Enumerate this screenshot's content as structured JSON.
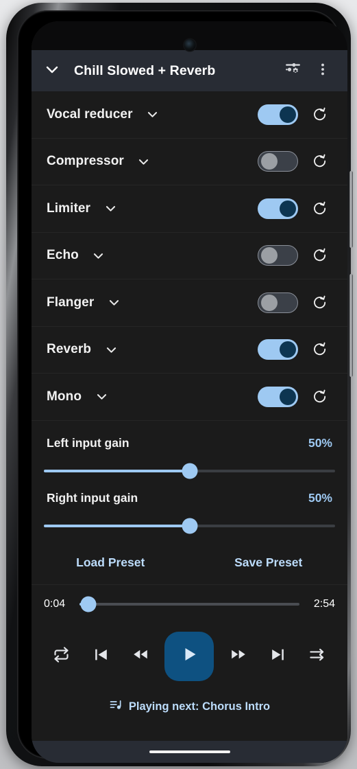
{
  "header": {
    "collapse_icon": "chevron-down-icon",
    "title": "Chill Slowed + Reverb",
    "tune_icon": "tune-settings-icon",
    "overflow_icon": "more-vertical-icon"
  },
  "effects": [
    {
      "name": "Vocal reducer",
      "enabled": true,
      "expand_icon": "chevron-down-icon",
      "reset_icon": "reset-icon"
    },
    {
      "name": "Compressor",
      "enabled": false,
      "expand_icon": "chevron-down-icon",
      "reset_icon": "reset-icon"
    },
    {
      "name": "Limiter",
      "enabled": true,
      "expand_icon": "chevron-down-icon",
      "reset_icon": "reset-icon"
    },
    {
      "name": "Echo",
      "enabled": false,
      "expand_icon": "chevron-down-icon",
      "reset_icon": "reset-icon"
    },
    {
      "name": "Flanger",
      "enabled": false,
      "expand_icon": "chevron-down-icon",
      "reset_icon": "reset-icon"
    },
    {
      "name": "Reverb",
      "enabled": true,
      "expand_icon": "chevron-down-icon",
      "reset_icon": "reset-icon"
    },
    {
      "name": "Mono",
      "enabled": true,
      "expand_icon": "chevron-down-icon",
      "reset_icon": "reset-icon"
    }
  ],
  "gains": [
    {
      "label": "Left input gain",
      "value_text": "50%",
      "percent": 50
    },
    {
      "label": "Right input gain",
      "value_text": "50%",
      "percent": 50
    }
  ],
  "presets": {
    "load_label": "Load Preset",
    "save_label": "Save Preset"
  },
  "player": {
    "elapsed": "0:04",
    "duration": "2:54",
    "progress_percent": 4,
    "repeat_icon": "repeat-icon",
    "previous_icon": "skip-previous-icon",
    "rewind_icon": "rewind-icon",
    "play_icon": "play-icon",
    "forward_icon": "fast-forward-icon",
    "next_icon": "skip-next-icon",
    "shuffle_icon": "shuffle-icon"
  },
  "next_up": {
    "queue_icon": "queue-music-icon",
    "text": "Playing next: Chorus Intro"
  },
  "colors": {
    "accent_light_blue": "#9ec9f2",
    "accent_link": "#bcdcfb",
    "toggle_knob_on": "#0d3551",
    "play_button": "#0e5181",
    "header_bg": "#282c34",
    "body_bg": "#1b1b1b"
  }
}
